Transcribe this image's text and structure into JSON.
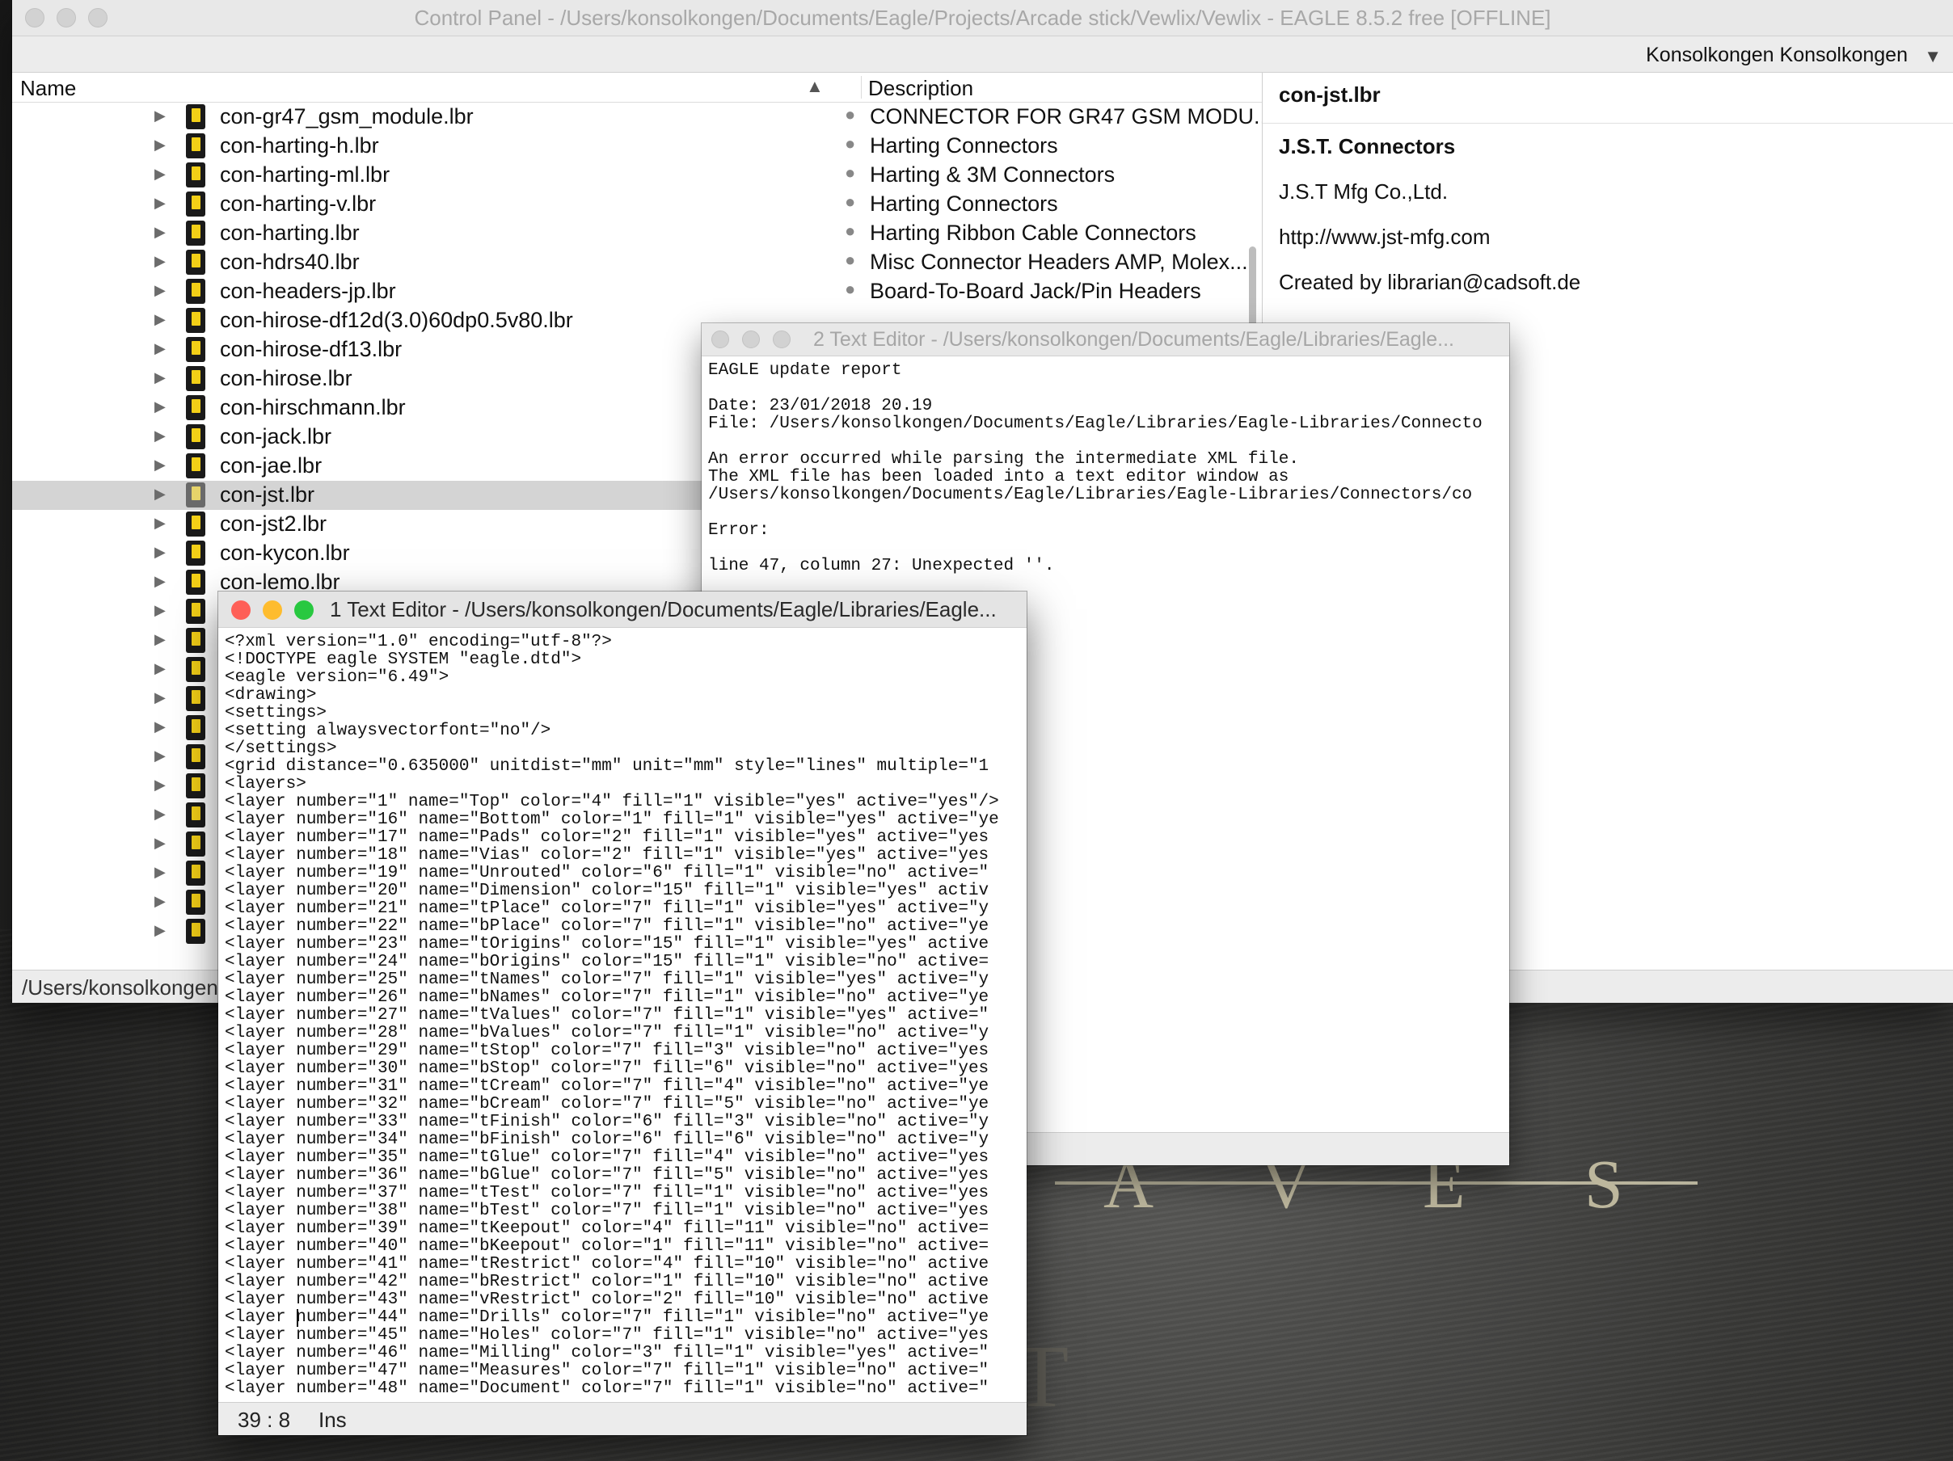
{
  "wallpaper": {
    "letters": [
      "A",
      "V",
      "E",
      "S"
    ],
    "glyph": "T"
  },
  "control_panel": {
    "title": "Control Panel - /Users/konsolkongen/Documents/Eagle/Projects/Arcade stick/Vewlix/Vewlix - EAGLE 8.5.2 free [OFFLINE]",
    "user": "Konsolkongen Konsolkongen",
    "columns": {
      "name": "Name",
      "description": "Description"
    },
    "rows": [
      {
        "name": "con-gr47_gsm_module.lbr",
        "description": "CONNECTOR FOR GR47 GSM MODU..."
      },
      {
        "name": "con-harting-h.lbr",
        "description": "Harting Connectors"
      },
      {
        "name": "con-harting-ml.lbr",
        "description": "Harting  & 3M Connectors"
      },
      {
        "name": "con-harting-v.lbr",
        "description": "Harting Connectors"
      },
      {
        "name": "con-harting.lbr",
        "description": "Harting Ribbon Cable Connectors"
      },
      {
        "name": "con-hdrs40.lbr",
        "description": "Misc Connector Headers AMP, Molex..."
      },
      {
        "name": "con-headers-jp.lbr",
        "description": "Board-To-Board Jack/Pin Headers"
      },
      {
        "name": "con-hirose-df12d(3.0)60dp0.5v80.lbr",
        "description": ""
      },
      {
        "name": "con-hirose-df13.lbr",
        "description": ""
      },
      {
        "name": "con-hirose.lbr",
        "description": ""
      },
      {
        "name": "con-hirschmann.lbr",
        "description": ""
      },
      {
        "name": "con-jack.lbr",
        "description": ""
      },
      {
        "name": "con-jae.lbr",
        "description": ""
      },
      {
        "name": "con-jst.lbr",
        "description": ""
      },
      {
        "name": "con-jst2.lbr",
        "description": ""
      },
      {
        "name": "con-kycon.lbr",
        "description": ""
      },
      {
        "name": "con-lemo.lbr",
        "description": ""
      },
      {
        "name": "",
        "description": ""
      },
      {
        "name": "",
        "description": ""
      },
      {
        "name": "",
        "description": ""
      },
      {
        "name": "",
        "description": ""
      },
      {
        "name": "",
        "description": ""
      },
      {
        "name": "",
        "description": ""
      },
      {
        "name": "",
        "description": ""
      },
      {
        "name": "",
        "description": ""
      },
      {
        "name": "",
        "description": ""
      },
      {
        "name": "",
        "description": ""
      },
      {
        "name": "",
        "description": ""
      },
      {
        "name": "",
        "description": ""
      }
    ],
    "selected_row": "con-jst.lbr",
    "detail": {
      "header": "con-jst.lbr",
      "heading": "J.S.T. Connectors",
      "company": "J.S.T Mfg Co.,Ltd.",
      "url": "http://www.jst-mfg.com",
      "created_by": "Created by librarian@cadsoft.de"
    },
    "status_path": "/Users/konsolkongen"
  },
  "text_editor_2": {
    "title": "2 Text Editor - /Users/konsolkongen/Documents/Eagle/Libraries/Eagle...",
    "lines": [
      "EAGLE update report",
      "",
      "Date: 23/01/2018 20.19",
      "File: /Users/konsolkongen/Documents/Eagle/Libraries/Eagle-Libraries/Connecto",
      "",
      "An error occurred while parsing the intermediate XML file.",
      "The XML file has been loaded into a text editor window as",
      "/Users/konsolkongen/Documents/Eagle/Libraries/Eagle-Libraries/Connectors/co",
      "",
      "Error:",
      "",
      "line 47, column 27: Unexpected ''."
    ]
  },
  "text_editor_1": {
    "title": "1 Text Editor - /Users/konsolkongen/Documents/Eagle/Libraries/Eagle...",
    "lines": [
      "<?xml version=\"1.0\" encoding=\"utf-8\"?>",
      "<!DOCTYPE eagle SYSTEM \"eagle.dtd\">",
      "<eagle version=\"6.49\">",
      "<drawing>",
      "<settings>",
      "<setting alwaysvectorfont=\"no\"/>",
      "</settings>",
      "<grid distance=\"0.635000\" unitdist=\"mm\" unit=\"mm\" style=\"lines\" multiple=\"1",
      "<layers>",
      "<layer number=\"1\" name=\"Top\" color=\"4\" fill=\"1\" visible=\"yes\" active=\"yes\"/>",
      "<layer number=\"16\" name=\"Bottom\" color=\"1\" fill=\"1\" visible=\"yes\" active=\"ye",
      "<layer number=\"17\" name=\"Pads\" color=\"2\" fill=\"1\" visible=\"yes\" active=\"yes",
      "<layer number=\"18\" name=\"Vias\" color=\"2\" fill=\"1\" visible=\"yes\" active=\"yes",
      "<layer number=\"19\" name=\"Unrouted\" color=\"6\" fill=\"1\" visible=\"no\" active=\"",
      "<layer number=\"20\" name=\"Dimension\" color=\"15\" fill=\"1\" visible=\"yes\" activ",
      "<layer number=\"21\" name=\"tPlace\" color=\"7\" fill=\"1\" visible=\"yes\" active=\"y",
      "<layer number=\"22\" name=\"bPlace\" color=\"7\" fill=\"1\" visible=\"no\" active=\"ye",
      "<layer number=\"23\" name=\"tOrigins\" color=\"15\" fill=\"1\" visible=\"yes\" active",
      "<layer number=\"24\" name=\"bOrigins\" color=\"15\" fill=\"1\" visible=\"no\" active=",
      "<layer number=\"25\" name=\"tNames\" color=\"7\" fill=\"1\" visible=\"yes\" active=\"y",
      "<layer number=\"26\" name=\"bNames\" color=\"7\" fill=\"1\" visible=\"no\" active=\"ye",
      "<layer number=\"27\" name=\"tValues\" color=\"7\" fill=\"1\" visible=\"yes\" active=\"",
      "<layer number=\"28\" name=\"bValues\" color=\"7\" fill=\"1\" visible=\"no\" active=\"y",
      "<layer number=\"29\" name=\"tStop\" color=\"7\" fill=\"3\" visible=\"no\" active=\"yes",
      "<layer number=\"30\" name=\"bStop\" color=\"7\" fill=\"6\" visible=\"no\" active=\"yes",
      "<layer number=\"31\" name=\"tCream\" color=\"7\" fill=\"4\" visible=\"no\" active=\"ye",
      "<layer number=\"32\" name=\"bCream\" color=\"7\" fill=\"5\" visible=\"no\" active=\"ye",
      "<layer number=\"33\" name=\"tFinish\" color=\"6\" fill=\"3\" visible=\"no\" active=\"y",
      "<layer number=\"34\" name=\"bFinish\" color=\"6\" fill=\"6\" visible=\"no\" active=\"y",
      "<layer number=\"35\" name=\"tGlue\" color=\"7\" fill=\"4\" visible=\"no\" active=\"yes",
      "<layer number=\"36\" name=\"bGlue\" color=\"7\" fill=\"5\" visible=\"no\" active=\"yes",
      "<layer number=\"37\" name=\"tTest\" color=\"7\" fill=\"1\" visible=\"no\" active=\"yes",
      "<layer number=\"38\" name=\"bTest\" color=\"7\" fill=\"1\" visible=\"no\" active=\"yes",
      "<layer number=\"39\" name=\"tKeepout\" color=\"4\" fill=\"11\" visible=\"no\" active=",
      "<layer number=\"40\" name=\"bKeepout\" color=\"1\" fill=\"11\" visible=\"no\" active=",
      "<layer number=\"41\" name=\"tRestrict\" color=\"4\" fill=\"10\" visible=\"no\" active",
      "<layer number=\"42\" name=\"bRestrict\" color=\"1\" fill=\"10\" visible=\"no\" active",
      "<layer number=\"43\" name=\"vRestrict\" color=\"2\" fill=\"10\" visible=\"no\" active",
      "<layer number=\"44\" name=\"Drills\" color=\"7\" fill=\"1\" visible=\"no\" active=\"ye",
      "<layer number=\"45\" name=\"Holes\" color=\"7\" fill=\"1\" visible=\"no\" active=\"yes",
      "<layer number=\"46\" name=\"Milling\" color=\"3\" fill=\"1\" visible=\"yes\" active=\"",
      "<layer number=\"47\" name=\"Measures\" color=\"7\" fill=\"1\" visible=\"no\" active=\"",
      "<layer number=\"48\" name=\"Document\" color=\"7\" fill=\"1\" visible=\"no\" active=\""
    ],
    "cursor_position": "39 : 8",
    "mode": "Ins"
  },
  "colors": {
    "close": "#fe5f57",
    "minimize": "#febc2e",
    "zoom": "#28c840",
    "inactive_traffic": "#d2d2d2",
    "library_icon": "#f3cf17",
    "selection": "#d4d4d4"
  }
}
